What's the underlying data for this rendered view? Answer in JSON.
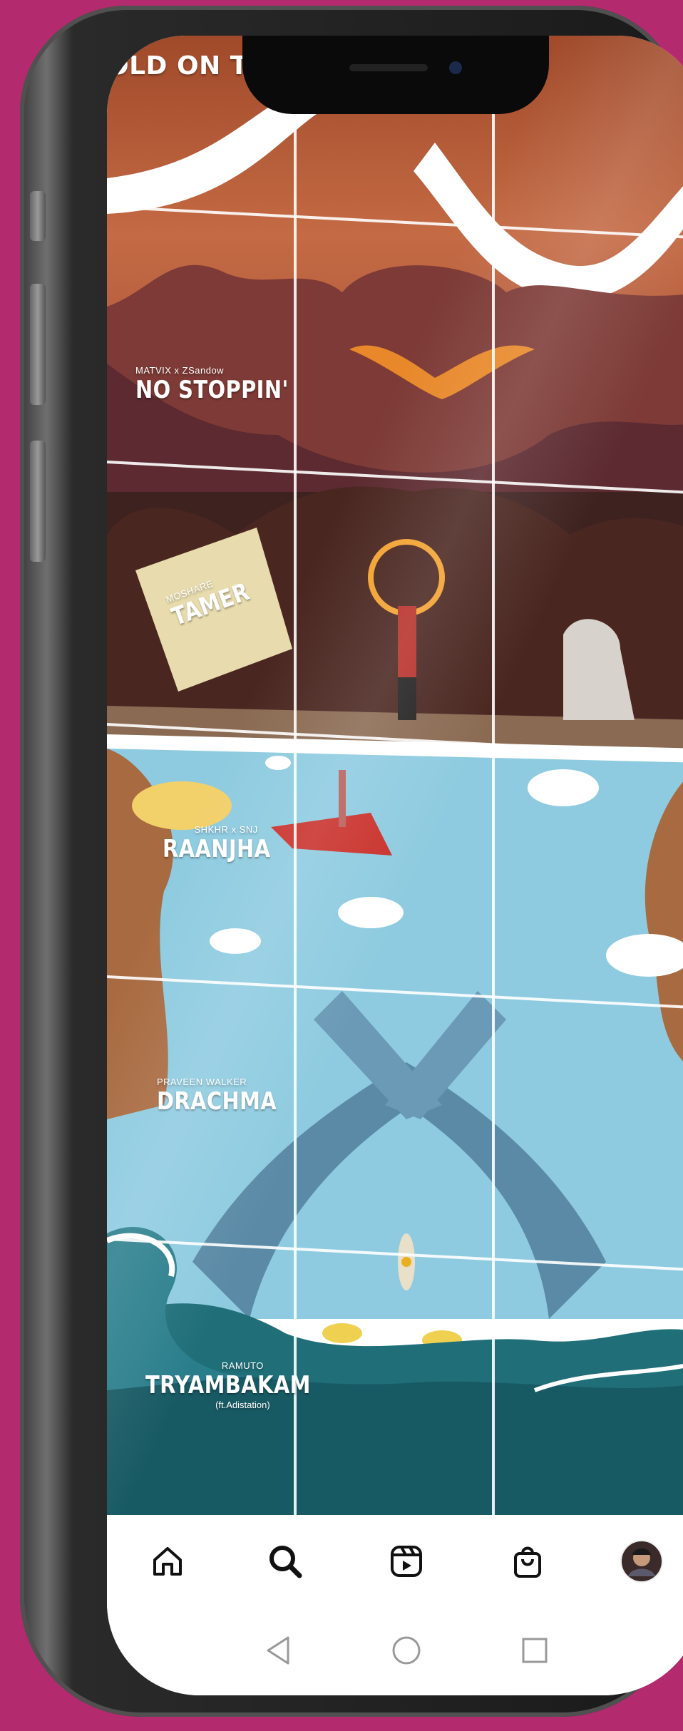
{
  "feed": {
    "top_banner_text": "OLD ON TO ME",
    "tiles": [
      {
        "artist": "MATVIX x ZSandow",
        "song": "NO STOPPIN'"
      },
      {
        "artist": "MOSHARE",
        "song": "TAMER"
      },
      {
        "artist": "SHKHR x SNJ",
        "song": "RAANJHA"
      },
      {
        "artist": "PRAVEEN WALKER",
        "song": "DRACHMA"
      },
      {
        "artist": "RAMUTO",
        "song": "TRYAMBAKAM",
        "featuring": "(ft.Adistation)"
      }
    ]
  },
  "bottom_nav": {
    "items": [
      {
        "name": "home",
        "icon": "home-icon"
      },
      {
        "name": "search",
        "icon": "search-icon"
      },
      {
        "name": "reels",
        "icon": "reels-icon"
      },
      {
        "name": "shop",
        "icon": "shopping-bag-icon"
      },
      {
        "name": "profile",
        "icon": "avatar"
      }
    ]
  },
  "system_nav": {
    "items": [
      {
        "name": "back",
        "icon": "triangle-back-icon"
      },
      {
        "name": "home",
        "icon": "circle-home-icon"
      },
      {
        "name": "recents",
        "icon": "square-recents-icon"
      }
    ]
  },
  "colors": {
    "background": "#b42a6e",
    "desert": "#b5603a",
    "sky": "#8ecbe0",
    "sea": "#1f6e78"
  }
}
